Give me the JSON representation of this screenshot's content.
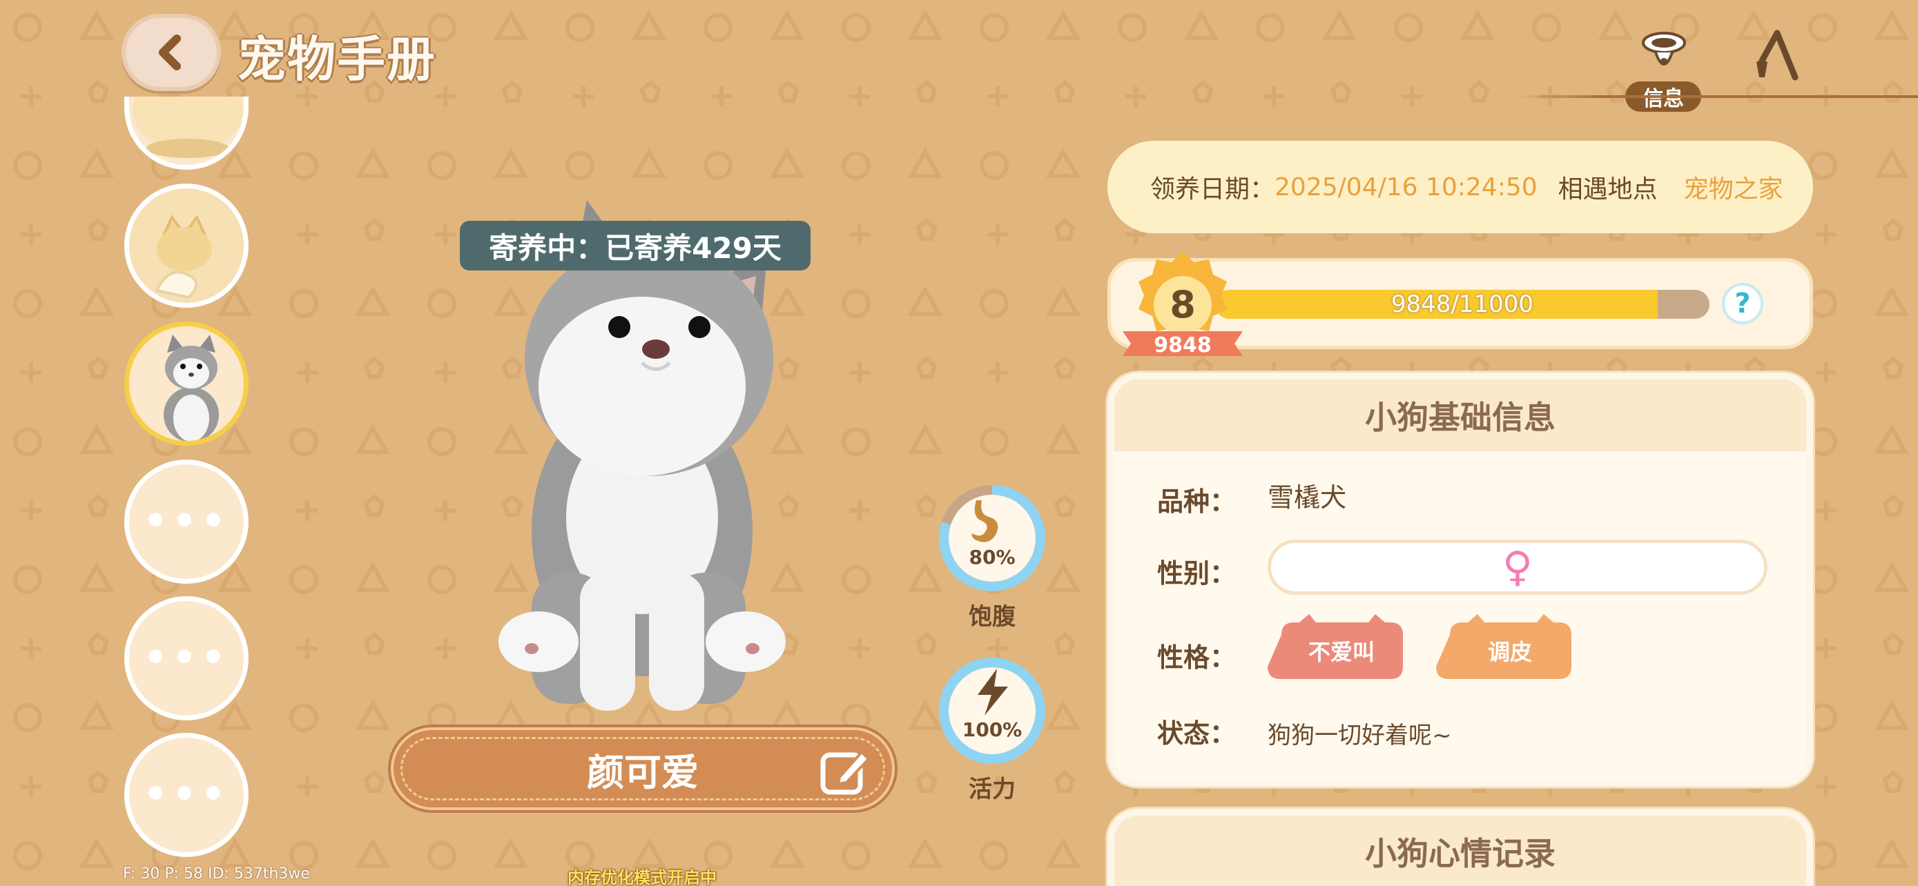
{
  "header": {
    "title": "宠物手册",
    "back_icon": "chevron-left-icon"
  },
  "tabs": {
    "info_label": "信息",
    "info_icon": "collar-icon",
    "tool_icon": "tool-icon"
  },
  "sidebar": {
    "slots": [
      {
        "state": "partial-pet"
      },
      {
        "state": "pet-cat-toast"
      },
      {
        "state": "pet-husky",
        "selected": true
      },
      {
        "state": "empty",
        "label": "•••"
      },
      {
        "state": "empty",
        "label": "•••"
      },
      {
        "state": "empty",
        "label": "•••"
      }
    ]
  },
  "pet": {
    "boarding_status": "寄养中：已寄养429天",
    "name": "颜可爱",
    "edit_icon": "edit-icon"
  },
  "gauges": {
    "satiety": {
      "percent_text": "80%",
      "label": "饱腹",
      "value": 0.8,
      "icon": "stomach-icon"
    },
    "energy": {
      "percent_text": "100%",
      "label": "活力",
      "value": 1.0,
      "icon": "lightning-icon"
    }
  },
  "adoption": {
    "date_label": "领养日期：",
    "date_value": "2025/04/16 10:24:50",
    "place_label": "相遇地点",
    "place_value": "宠物之家"
  },
  "level": {
    "level": "8",
    "ribbon_value": "9848",
    "xp_text": "9848/11000",
    "xp_fraction": 0.895,
    "help_label": "?"
  },
  "basic_info": {
    "title": "小狗基础信息",
    "breed_label": "品种：",
    "breed_value": "雪橇犬",
    "gender_label": "性别：",
    "gender_symbol": "♀",
    "personality_label": "性格：",
    "traits": [
      "不爱叫",
      "调皮"
    ],
    "status_label": "状态：",
    "status_value": "狗狗一切好着呢~"
  },
  "mood": {
    "title": "小狗心情记录"
  },
  "debug": {
    "text": "F: 30    P: 58    ID: 537th3we"
  },
  "memory_notice": "内存优化模式开启中",
  "colors": {
    "background": "#e1b57e",
    "accent": "#d28c54",
    "xp": "#f9c92d",
    "trait_red": "#ec8a79",
    "trait_orange": "#f3a96a"
  }
}
